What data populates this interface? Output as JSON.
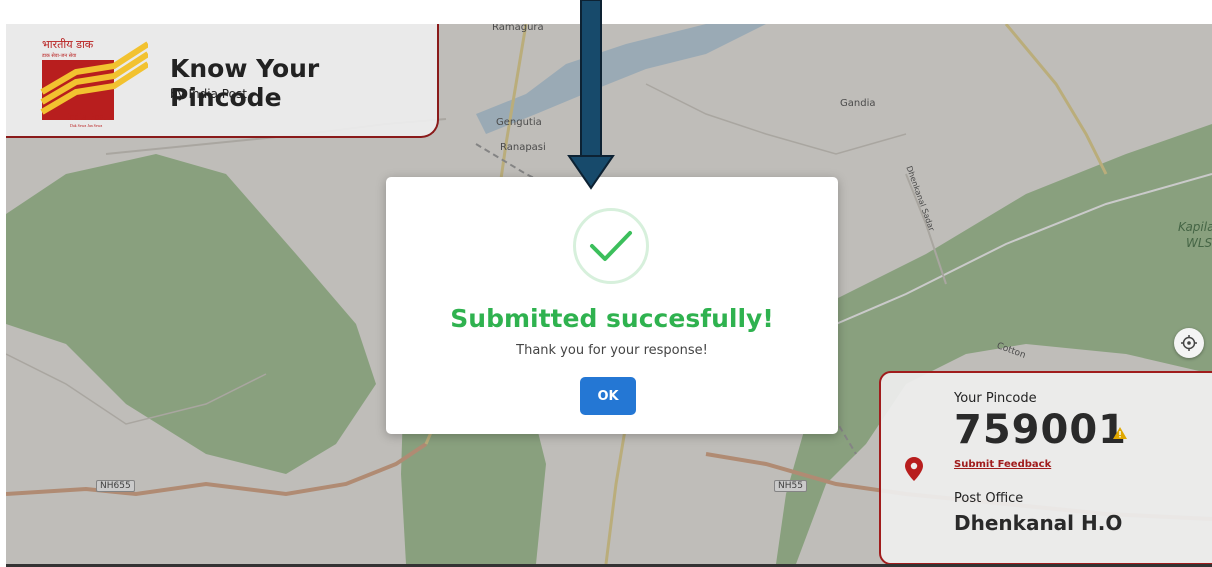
{
  "header": {
    "logo_hindi": "भारतीय डाक",
    "logo_tagline_hindi": "डाक सेवा-जन सेवा",
    "logo_brand": "India Post",
    "logo_brand_tagline": "Dak Sewa Jan Sewa",
    "title": "Know Your Pincode",
    "subtitle": "by India Post"
  },
  "map": {
    "labels": [
      "Ramagura",
      "Gengutia",
      "Ranapasi",
      "Gandia",
      "Dhenkanal Sadar",
      "Kapila",
      "WLS",
      "Cotton"
    ],
    "roads": [
      "NH655",
      "NH55"
    ]
  },
  "modal": {
    "icon": "check-icon",
    "title": "Submitted succesfully!",
    "message": "Thank you for your response!",
    "ok_label": "OK"
  },
  "pincode_card": {
    "pincode_label": "Your Pincode",
    "pincode": "759001",
    "feedback_link": "Submit Feedback",
    "post_office_label": "Post Office",
    "post_office": "Dhenkanal H.O"
  },
  "colors": {
    "accent_red": "#a01c1c",
    "success_green": "#2fb24f",
    "button_blue": "#2477d4",
    "arrow_blue": "#174a6b"
  }
}
